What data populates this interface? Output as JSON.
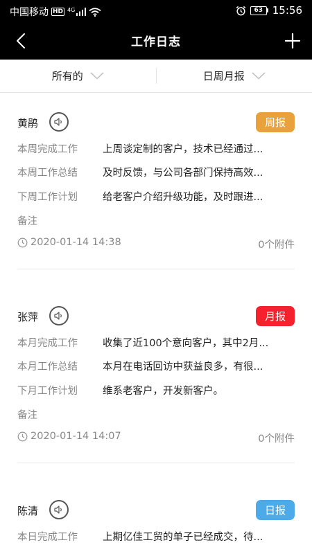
{
  "status_bar": {
    "carrier": "中国移动",
    "hd": "HD",
    "network": "4G",
    "battery": "63",
    "time": "15:56"
  },
  "nav": {
    "title": "工作日志",
    "back_icon": "chevron-left-icon",
    "add_icon": "plus-icon"
  },
  "filters": {
    "scope": "所有的",
    "period": "日周月报"
  },
  "colors": {
    "weekly_badge": "#E9A23B",
    "monthly_badge": "#F5212D",
    "daily_badge": "#4DAAE8"
  },
  "entries": [
    {
      "name": "黄鹃",
      "badge": "周报",
      "badge_color": "#E9A23B",
      "rows": [
        {
          "label": "本周完成工作",
          "value": "上周谈定制的客户，技术已经通过..."
        },
        {
          "label": "本周工作总结",
          "value": "及时反馈，与公司各部门保持高效..."
        },
        {
          "label": "下周工作计划",
          "value": "给老客户介绍升级功能，及时跟进..."
        },
        {
          "label": "备注",
          "value": ""
        }
      ],
      "time": "2020-01-14 14:38",
      "attachments": "0个附件"
    },
    {
      "name": "张萍",
      "badge": "月报",
      "badge_color": "#F5212D",
      "rows": [
        {
          "label": "本月完成工作",
          "value": "收集了近100个意向客户，其中2月..."
        },
        {
          "label": "本月工作总结",
          "value": "本月在电话回访中获益良多，有很..."
        },
        {
          "label": "下月工作计划",
          "value": "维系老客户，开发新客户。"
        },
        {
          "label": "备注",
          "value": ""
        }
      ],
      "time": "2020-01-14 14:07",
      "attachments": "0个附件"
    },
    {
      "name": "陈清",
      "badge": "日报",
      "badge_color": "#4DAAE8",
      "rows": [
        {
          "label": "本日完成工作",
          "value": "上期亿佳工贸的单子已经成交，待..."
        }
      ],
      "time": "",
      "attachments": ""
    }
  ]
}
